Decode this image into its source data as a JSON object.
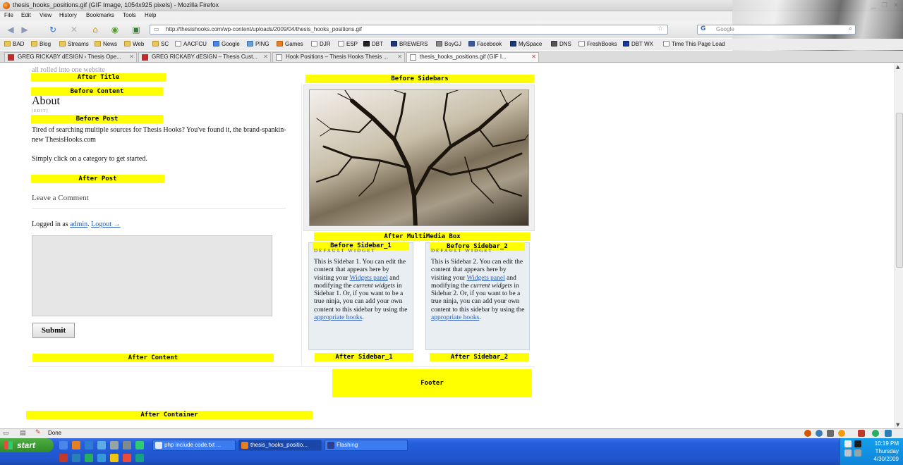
{
  "window": {
    "title": "thesis_hooks_positions.gif (GIF Image, 1054x925 pixels) - Mozilla Firefox"
  },
  "menu": [
    "File",
    "Edit",
    "View",
    "History",
    "Bookmarks",
    "Tools",
    "Help"
  ],
  "nav": {
    "url": "http://thesishooks.com/wp-content/uploads/2009/04/thesis_hooks_positions.gif",
    "search_placeholder": "Google"
  },
  "bookmarks": [
    "BAD",
    "Blog",
    "Streams",
    "News",
    "Web",
    "SC",
    "AACFCU",
    "Google",
    "PING",
    "Games",
    "DJR",
    "ESP",
    "DBT",
    "BREWERS",
    "BoyGJ",
    "Facebook",
    "MySpace",
    "DNS",
    "FreshBooks",
    "DBT WX",
    "Time This Page Load"
  ],
  "tabs": [
    {
      "label": "GREG RICKABY dESIGN › Thesis Ope..."
    },
    {
      "label": "GREG RICKABY dESIGN – Thesis Cust..."
    },
    {
      "label": "Hook Positions – Thesis Hooks Thesis ..."
    },
    {
      "label": "thesis_hooks_positions.gif (GIF I..."
    }
  ],
  "page": {
    "tagline": "all rolled into one website",
    "hooks": {
      "after_title": "After Title",
      "before_content": "Before Content",
      "before_post": "Before Post",
      "after_post": "After Post",
      "after_content": "After Content",
      "before_sidebars": "Before Sidebars",
      "after_multimedia": "After MultiMedia Box",
      "before_sidebar_1": "Before Sidebar_1",
      "before_sidebar_2": "Before Sidebar_2",
      "after_sidebar_1": "After Sidebar_1",
      "after_sidebar_2": "After Sidebar_2",
      "footer": "Footer",
      "after_container": "After Container"
    },
    "heading": "About",
    "edit": "[EDIT]",
    "para1": "Tired of searching multiple sources for Thesis Hooks? You've found it, the brand-spankin-new ThesisHooks.com",
    "para2": "Simply click on a category to get started.",
    "leave_comment": "Leave a Comment",
    "logged_in_prefix": "Logged in as",
    "logged_in_user": "admin",
    "logged_in_sep": ".",
    "logout": "Logout →",
    "submit": "Submit",
    "widget_title": "DEFAULT WIDGET",
    "sidebar1": {
      "t1": "This is Sidebar 1. You can edit the content that appears here by visiting your",
      "link1": "Widgets panel",
      "t2": "and modifying the",
      "em": "current widgets",
      "t3": "in Sidebar 1. Or, if you want to be a true ninja, you can add your own content to this sidebar by using the",
      "link2": "appropriate hooks",
      "t4": "."
    },
    "sidebar2": {
      "t1": "This is Sidebar 2. You can edit the content that appears here by visiting your",
      "link1": "Widgets panel",
      "t2": "and modifying the",
      "em": "current widgets",
      "t3": "in Sidebar 2. Or, if you want to be a true ninja, you can add your own content to this sidebar by using the",
      "link2": "appropriate hooks",
      "t4": "."
    }
  },
  "status": {
    "text": "Done"
  },
  "taskbar": {
    "start": "start",
    "items": [
      "php include code.txt ...",
      "thesis_hooks_positio...",
      "Flashing"
    ],
    "time": "10:19 PM",
    "day": "Thursday",
    "date": "4/30/2009"
  }
}
